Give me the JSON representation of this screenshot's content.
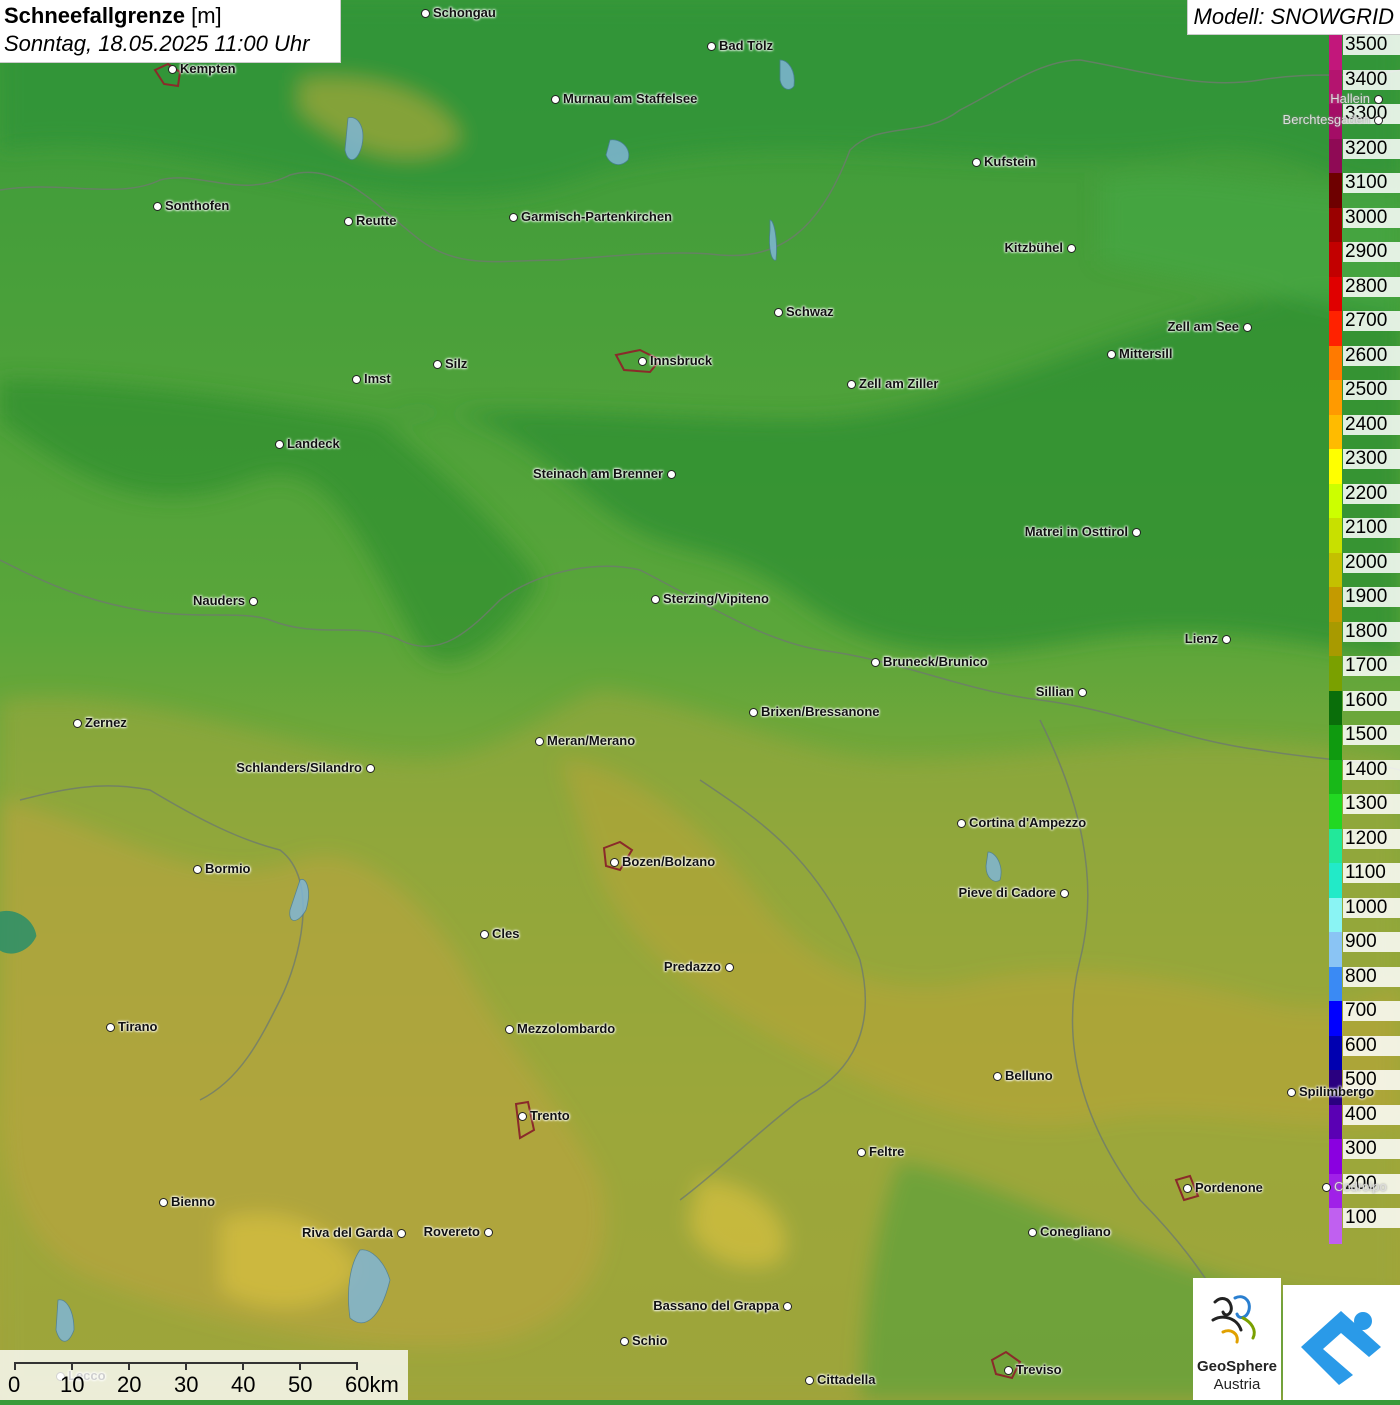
{
  "header": {
    "title": "Schneefallgrenze",
    "unit": "[m]",
    "datetime": "Sonntag, 18.05.2025 11:00 Uhr"
  },
  "model": {
    "label": "Modell: SNOWGRID"
  },
  "legend": {
    "levels": [
      {
        "value": "3500",
        "color": "#c2177b"
      },
      {
        "value": "3400",
        "color": "#b4146f"
      },
      {
        "value": "3300",
        "color": "#a40d66"
      },
      {
        "value": "3200",
        "color": "#8f0a55"
      },
      {
        "value": "3100",
        "color": "#6e0000"
      },
      {
        "value": "3000",
        "color": "#9a0000"
      },
      {
        "value": "2900",
        "color": "#c20000"
      },
      {
        "value": "2800",
        "color": "#e00000"
      },
      {
        "value": "2700",
        "color": "#ff2200"
      },
      {
        "value": "2600",
        "color": "#ff7a00"
      },
      {
        "value": "2500",
        "color": "#ff9a00"
      },
      {
        "value": "2400",
        "color": "#ffbb00"
      },
      {
        "value": "2300",
        "color": "#ffff00"
      },
      {
        "value": "2200",
        "color": "#ccff00"
      },
      {
        "value": "2100",
        "color": "#c8e000"
      },
      {
        "value": "2000",
        "color": "#c4c000"
      },
      {
        "value": "1900",
        "color": "#c49a00"
      },
      {
        "value": "1800",
        "color": "#a89a00"
      },
      {
        "value": "1700",
        "color": "#7aa000"
      },
      {
        "value": "1600",
        "color": "#0a6e0a"
      },
      {
        "value": "1500",
        "color": "#0f9a0f"
      },
      {
        "value": "1400",
        "color": "#18b818"
      },
      {
        "value": "1300",
        "color": "#22d822"
      },
      {
        "value": "1200",
        "color": "#22e89a"
      },
      {
        "value": "1100",
        "color": "#22eac8"
      },
      {
        "value": "1000",
        "color": "#8af4f4"
      },
      {
        "value": "900",
        "color": "#8ac4f4"
      },
      {
        "value": "800",
        "color": "#3a8af4"
      },
      {
        "value": "700",
        "color": "#0000ff"
      },
      {
        "value": "600",
        "color": "#0000b0"
      },
      {
        "value": "500",
        "color": "#2a0080"
      },
      {
        "value": "400",
        "color": "#5a00b4"
      },
      {
        "value": "300",
        "color": "#8a00e0"
      },
      {
        "value": "200",
        "color": "#a020e8"
      },
      {
        "value": "100",
        "color": "#c060f0"
      }
    ]
  },
  "places": [
    {
      "name": "Schongau"
    },
    {
      "name": "Bad Tölz"
    },
    {
      "name": "Kempten"
    },
    {
      "name": "Hallein"
    },
    {
      "name": "Murnau am Staffelsee"
    },
    {
      "name": "Berchtesgaden"
    },
    {
      "name": "Kufstein"
    },
    {
      "name": "Sonthofen"
    },
    {
      "name": "Reutte"
    },
    {
      "name": "Garmisch-Partenkirchen"
    },
    {
      "name": "Kitzbühel"
    },
    {
      "name": "Schwaz"
    },
    {
      "name": "Zell am See"
    },
    {
      "name": "Innsbruck"
    },
    {
      "name": "Mittersill"
    },
    {
      "name": "Imst"
    },
    {
      "name": "Silz"
    },
    {
      "name": "Zell am Ziller"
    },
    {
      "name": "Landeck"
    },
    {
      "name": "Steinach am Brenner"
    },
    {
      "name": "Matrei in Osttirol"
    },
    {
      "name": "Nauders"
    },
    {
      "name": "Sterzing/Vipiteno"
    },
    {
      "name": "Lienz"
    },
    {
      "name": "Bruneck/Brunico"
    },
    {
      "name": "Sillian"
    },
    {
      "name": "Zernez"
    },
    {
      "name": "Brixen/Bressanone"
    },
    {
      "name": "Meran/Merano"
    },
    {
      "name": "Schlanders/Silandro"
    },
    {
      "name": "Cortina d'Ampezzo"
    },
    {
      "name": "Bozen/Bolzano"
    },
    {
      "name": "Bormio"
    },
    {
      "name": "Pieve di Cadore"
    },
    {
      "name": "Cles"
    },
    {
      "name": "Predazzo"
    },
    {
      "name": "Tirano"
    },
    {
      "name": "Mezzolombardo"
    },
    {
      "name": "Belluno"
    },
    {
      "name": "Spilimbergo"
    },
    {
      "name": "Trento"
    },
    {
      "name": "Feltre"
    },
    {
      "name": "Pordenone"
    },
    {
      "name": "Bienno"
    },
    {
      "name": "Riva del Garda"
    },
    {
      "name": "Rovereto"
    },
    {
      "name": "Conegliano"
    },
    {
      "name": "Bassano del Grappa"
    },
    {
      "name": "Schio"
    },
    {
      "name": "Treviso"
    },
    {
      "name": "Cittadella"
    },
    {
      "name": "Lecco"
    },
    {
      "name": "Codroipo"
    }
  ],
  "scale": {
    "labels": [
      "0",
      "10",
      "20",
      "30",
      "40",
      "50",
      "60km"
    ]
  },
  "logos": {
    "geosphere_line1": "GeoSphere",
    "geosphere_line2": "Austria"
  }
}
